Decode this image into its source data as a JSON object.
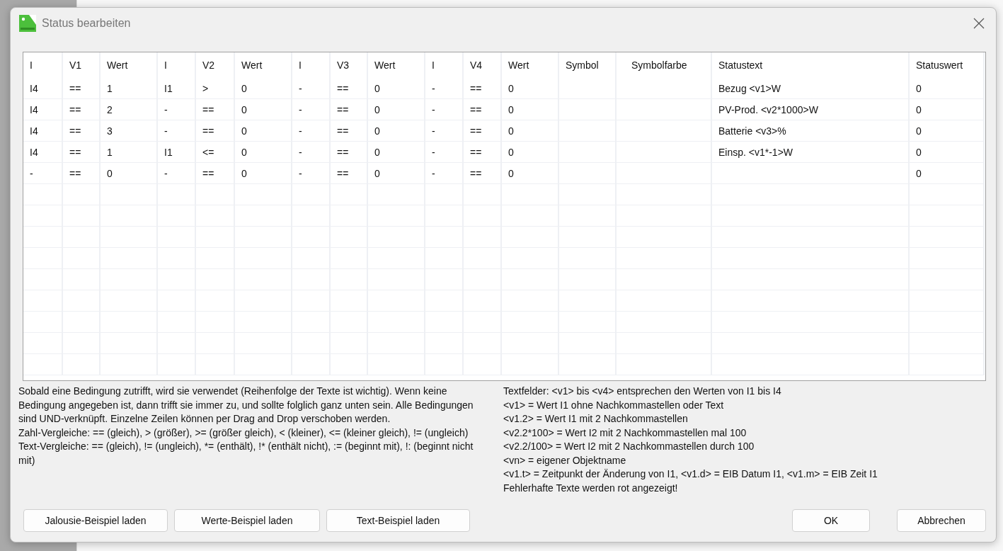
{
  "window": {
    "title": "Status bearbeiten"
  },
  "table": {
    "columns": [
      "I",
      "V1",
      "Wert",
      "I",
      "V2",
      "Wert",
      "I",
      "V3",
      "Wert",
      "I",
      "V4",
      "Wert",
      "Symbol",
      "Symbolfarbe",
      "Statustext",
      "Statuswert"
    ],
    "rows": [
      {
        "conditions": [
          {
            "input": "I4",
            "op": "==",
            "value": "1"
          },
          {
            "input": "I1",
            "op": ">",
            "value": "0"
          },
          {
            "input": "-",
            "op": "==",
            "value": "0"
          },
          {
            "input": "-",
            "op": "==",
            "value": "0"
          }
        ],
        "status_text": "Bezug <v1>W",
        "status_value": "0"
      },
      {
        "conditions": [
          {
            "input": "I4",
            "op": "==",
            "value": "2"
          },
          {
            "input": "-",
            "op": "==",
            "value": "0"
          },
          {
            "input": "-",
            "op": "==",
            "value": "0"
          },
          {
            "input": "-",
            "op": "==",
            "value": "0"
          }
        ],
        "status_text": "PV-Prod. <v2*1000>W",
        "status_value": "0"
      },
      {
        "conditions": [
          {
            "input": "I4",
            "op": "==",
            "value": "3"
          },
          {
            "input": "-",
            "op": "==",
            "value": "0"
          },
          {
            "input": "-",
            "op": "==",
            "value": "0"
          },
          {
            "input": "-",
            "op": "==",
            "value": "0"
          }
        ],
        "status_text": "Batterie <v3>%",
        "status_value": "0"
      },
      {
        "conditions": [
          {
            "input": "I4",
            "op": "==",
            "value": "1"
          },
          {
            "input": "I1",
            "op": "<=",
            "value": "0"
          },
          {
            "input": "-",
            "op": "==",
            "value": "0"
          },
          {
            "input": "-",
            "op": "==",
            "value": "0"
          }
        ],
        "status_text": "Einsp. <v1*-1>W",
        "status_value": "0"
      },
      {
        "conditions": [
          {
            "input": "-",
            "op": "==",
            "value": "0"
          },
          {
            "input": "-",
            "op": "==",
            "value": "0"
          },
          {
            "input": "-",
            "op": "==",
            "value": "0"
          },
          {
            "input": "-",
            "op": "==",
            "value": "0"
          }
        ],
        "status_value": "0"
      }
    ]
  },
  "help_left": [
    "Sobald eine Bedingung zutrifft, wird sie verwendet (Reihenfolge der Texte ist wichtig). Wenn keine Bedingung angegeben ist, dann trifft sie immer zu, und sollte folglich ganz unten sein. Alle Bedingungen sind UND-verknüpft. Einzelne Zeilen können per Drag and Drop verschoben werden.",
    "Zahl-Vergleiche: == (gleich), > (größer), >= (größer gleich), < (kleiner), <= (kleiner gleich), != (ungleich)",
    "Text-Vergleiche: == (gleich), != (ungleich), *= (enthält), !* (enthält nicht), := (beginnt mit), !: (beginnt nicht mit)"
  ],
  "help_right": [
    "Textfelder: <v1> bis <v4> entsprechen den Werten von I1 bis I4",
    "<v1> = Wert I1 ohne Nachkommastellen oder Text",
    "<v1.2> = Wert I1 mit 2 Nachkommastellen",
    "<v2.2*100> = Wert I2 mit 2 Nachkommastellen mal 100",
    "<v2.2/100> = Wert I2 mit 2 Nachkommastellen durch 100",
    "<vn> = eigener Objektname",
    "<v1.t> = Zeitpunkt der Änderung von I1, <v1.d> = EIB Datum I1, <v1.m> = EIB Zeit I1",
    "Fehlerhafte Texte werden rot angezeigt!"
  ],
  "example_buttons": [
    "Jalousie-Beispiel laden",
    "Werte-Beispiel laden",
    "Text-Beispiel laden"
  ],
  "buttons": [
    "OK",
    "Abbrechen"
  ]
}
